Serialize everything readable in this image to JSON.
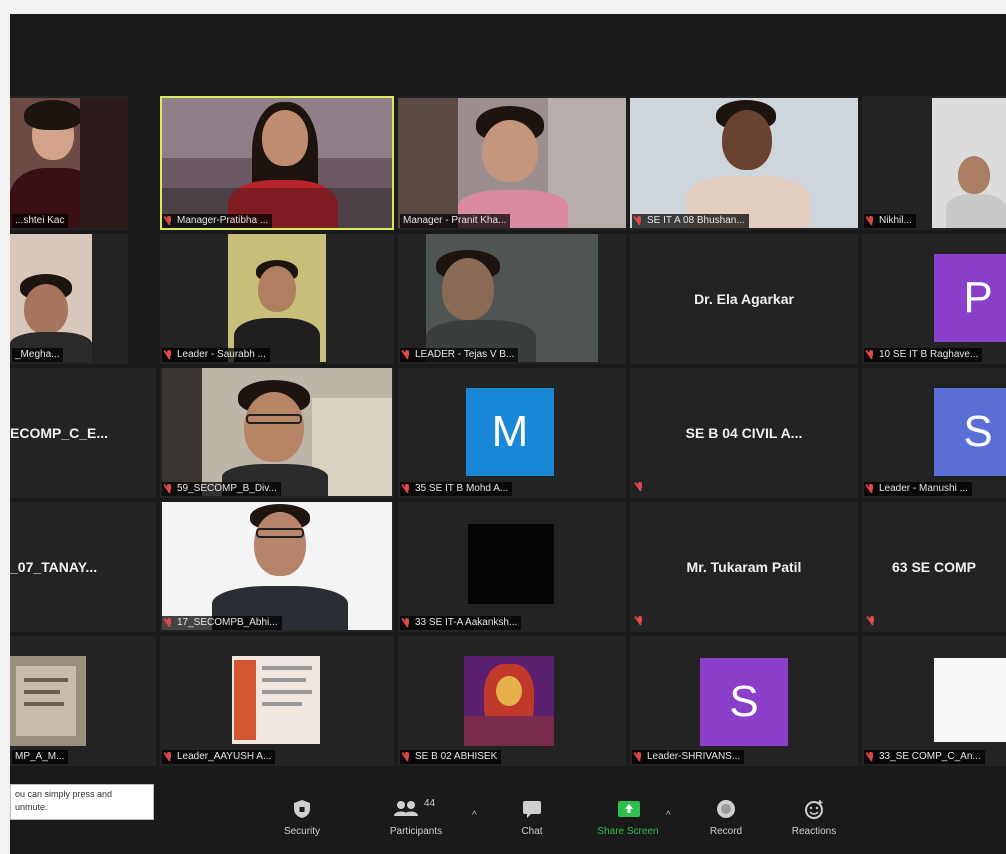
{
  "colors": {
    "active_border": "#d7ea5a",
    "tile_bg": "#232323",
    "share_green": "#2fbf4f",
    "muted_red": "#e04848",
    "avatar_purple": "#8a3fc8",
    "avatar_blue": "#1a88d9",
    "avatar_indigo": "#5a6fd6"
  },
  "tiles": {
    "r1c1": {
      "name": "...shtei Kac"
    },
    "r1c2": {
      "name": "Manager-Pratibha ..."
    },
    "r1c3": {
      "name": "Manager - Pranit Kha..."
    },
    "r1c4": {
      "name": "SE IT A 08 Bhushan..."
    },
    "r1c5": {
      "name": "Nikhil..."
    },
    "r2c1": {
      "name": "_Megha..."
    },
    "r2c2": {
      "name": "Leader - Saurabh ..."
    },
    "r2c3": {
      "name": "LEADER - Tejas V B..."
    },
    "r2c4": {
      "name": "Dr. Ela Agarkar"
    },
    "r2c5": {
      "name": "10 SE IT B Raghave...",
      "avatar_letter": "P"
    },
    "r3c1": {
      "name": "ECOMP_C_E..."
    },
    "r3c2": {
      "name": "59_SECOMP_B_Div..."
    },
    "r3c3": {
      "name": "35 SE IT B Mohd A...",
      "avatar_letter": "M"
    },
    "r3c4": {
      "name": "SE B 04 CIVIL A..."
    },
    "r3c5": {
      "name": "Leader - Manushi ...",
      "avatar_letter": "S"
    },
    "r4c1": {
      "name": "_07_TANAY..."
    },
    "r4c2": {
      "name": "17_SECOMPB_Abhi..."
    },
    "r4c3": {
      "name": "33 SE IT-A Aakanksh..."
    },
    "r4c4": {
      "name": "Mr. Tukaram Patil"
    },
    "r4c5": {
      "name": "63 SE COMP"
    },
    "r5c1": {
      "name": "MP_A_M..."
    },
    "r5c2": {
      "name": "Leader_AAYUSH A..."
    },
    "r5c3": {
      "name": "SE B 02 ABHISEK"
    },
    "r5c4": {
      "name": "Leader-SHRIVANS...",
      "avatar_letter": "S"
    },
    "r5c5": {
      "name": "33_SE COMP_C_An..."
    }
  },
  "tooltip": {
    "line1": "ou can simply press and",
    "line2": "unmute."
  },
  "toolbar": {
    "security": "Security",
    "participants": "Participants",
    "participants_count": "44",
    "chat": "Chat",
    "share_screen": "Share Screen",
    "record": "Record",
    "reactions": "Reactions"
  }
}
